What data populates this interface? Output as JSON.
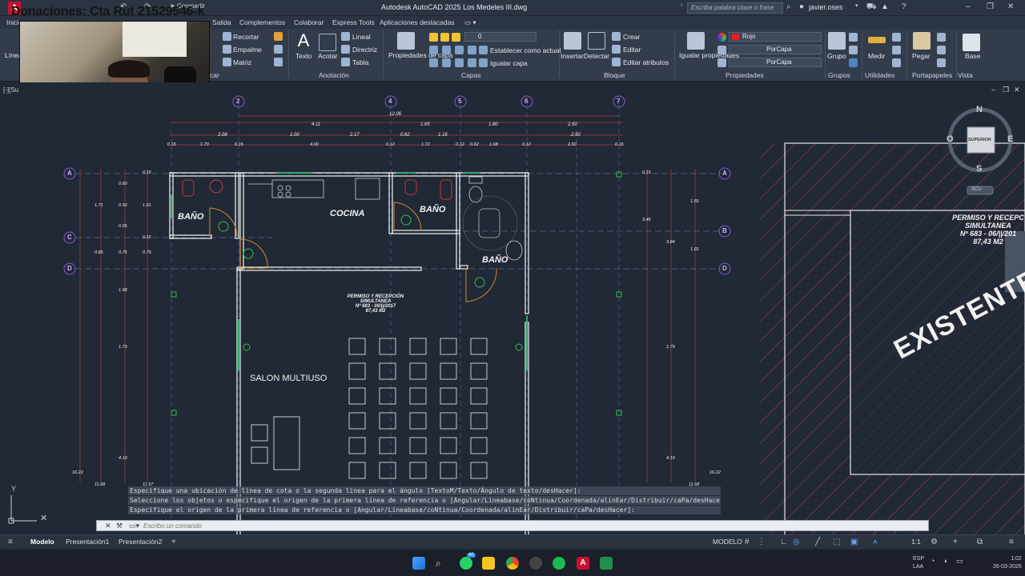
{
  "titlebar": {
    "title": "Autodesk AutoCAD 2025    Los Medeles III.dwg",
    "search_placeholder": "Escriba palabra clave o frase",
    "user": "javier.oses",
    "share": "Compartir"
  },
  "stream_overlay": {
    "donation_text": "Donaciones: Cta Rut 21529546-k"
  },
  "ribbon_tabs": [
    "Inicio",
    "Salida",
    "Complementos",
    "Colaborar",
    "Express Tools",
    "Aplicaciones destacadas"
  ],
  "ribbon": {
    "modify": {
      "recortar": "Recortar",
      "empalme": "Empalme",
      "matriz": "Matriz",
      "panel_tail": "car"
    },
    "annotation": {
      "texto": "Texto",
      "acotar": "Acotar",
      "lineal": "Lineal",
      "directriz": "Directriz",
      "tabla": "Tabla",
      "panel": "Anotación"
    },
    "layers": {
      "layer_props": "Propiedades de capa",
      "current_layer": "0",
      "set_current": "Establecer como actual",
      "match_layer": "Igualar capa",
      "panel": "Capas"
    },
    "block": {
      "insertar": "Insertar",
      "detectar": "Detectar",
      "crear": "Crear",
      "editar": "Editar",
      "editar_atributos": "Editar atributos",
      "panel": "Bloque"
    },
    "properties": {
      "match_props": "Igualar propiedades",
      "color": "Rojo",
      "linetype": "PorCapa",
      "lineweight": "PorCapa",
      "panel": "Propiedades",
      "color_hex": "#e02020"
    },
    "groups": {
      "grupo": "Grupo",
      "panel": "Grupos"
    },
    "utilities": {
      "medir": "Medir",
      "panel": "Utilidades"
    },
    "clipboard": {
      "pegar": "Pegar",
      "panel": "Portapapeles"
    },
    "view": {
      "base": "Base",
      "panel": "Vista"
    },
    "draw": {
      "linea": "Línea"
    }
  },
  "drawing": {
    "viewport_label": "[-][Su",
    "grid_columns": [
      "2",
      "4",
      "5",
      "6",
      "7"
    ],
    "grid_rows_left": [
      "A",
      "C",
      "D"
    ],
    "grid_rows_right": [
      "A",
      "B",
      "D"
    ],
    "rooms": {
      "bano_1": "BAÑO",
      "cocina": "COCINA",
      "bano_2": "BAÑO",
      "bano_3": "BAÑO",
      "salon": "SALON MULTIUSO"
    },
    "permit_center": [
      "PERMISO Y RECEPCIÓN",
      "SIMULTANEA",
      "Nº 683 - 06/||/2017",
      "87,43 M2"
    ],
    "permit_right": [
      "PERMISO Y RECEPC",
      "SIMULTANEA",
      "Nº 683 - 06/||/201",
      "87,43 M2"
    ],
    "existente": "EXISTENTE",
    "dim_top": [
      "12.06",
      "4.11",
      "1.65",
      "1.80",
      "2.50"
    ],
    "dim_row2": [
      "2.08",
      "1.00",
      "2.17",
      "0.62",
      "1.16",
      "2.50"
    ],
    "dim_row3": [
      "0.15",
      "1.70",
      "0.15",
      "4.00",
      "0.12",
      "1.72",
      "0.12",
      "0.62",
      "1.68",
      "0.12",
      "2.50",
      "0.15"
    ],
    "dim_left": [
      "0.15",
      "0.60",
      "1.71",
      "0.50",
      "1.61",
      "0.65",
      "0.15",
      "0.85",
      "0.75",
      "0.75",
      "1.68",
      "1.73",
      "4.19",
      "16.22",
      "11.68",
      "11.57"
    ],
    "dim_right": [
      "0.15",
      "1.55",
      "3.46",
      "3.84",
      "1.01",
      "1.79",
      "4.19",
      "16.22",
      "11.68"
    ],
    "viewcube": {
      "n": "N",
      "s": "S",
      "e": "E",
      "o": "O",
      "face": "SUPERIOR",
      "scu": "SCU"
    }
  },
  "command": {
    "history": [
      "Especifique una ubicación de línea de cota o la segunda línea para el ángulo [TextoM/Texto/Ángulo de texto/desHacer]:",
      "Seleccione los objetos o especifique el origen de la primera línea de referencia o [Angular/Líneabase/coNtinua/Coordenada/alinEar/Distribuir/caPa/desHacer]:",
      "Especifique el origen de la primera línea de referencia o [Angular/Líneabase/coNtinua/Coordenada/alinEar/Distribuir/caPa/desHacer]:"
    ],
    "placeholder": "Escribo un comando"
  },
  "layout_tabs": [
    "Modelo",
    "Presentación1",
    "Presentación2"
  ],
  "status": {
    "mode": "MODELO",
    "scale": "1:1"
  },
  "taskbar": {
    "whatsapp_badge": "40",
    "lang": [
      "ESP",
      "LAA"
    ],
    "time": "1:02",
    "date": "26-03-2026"
  }
}
